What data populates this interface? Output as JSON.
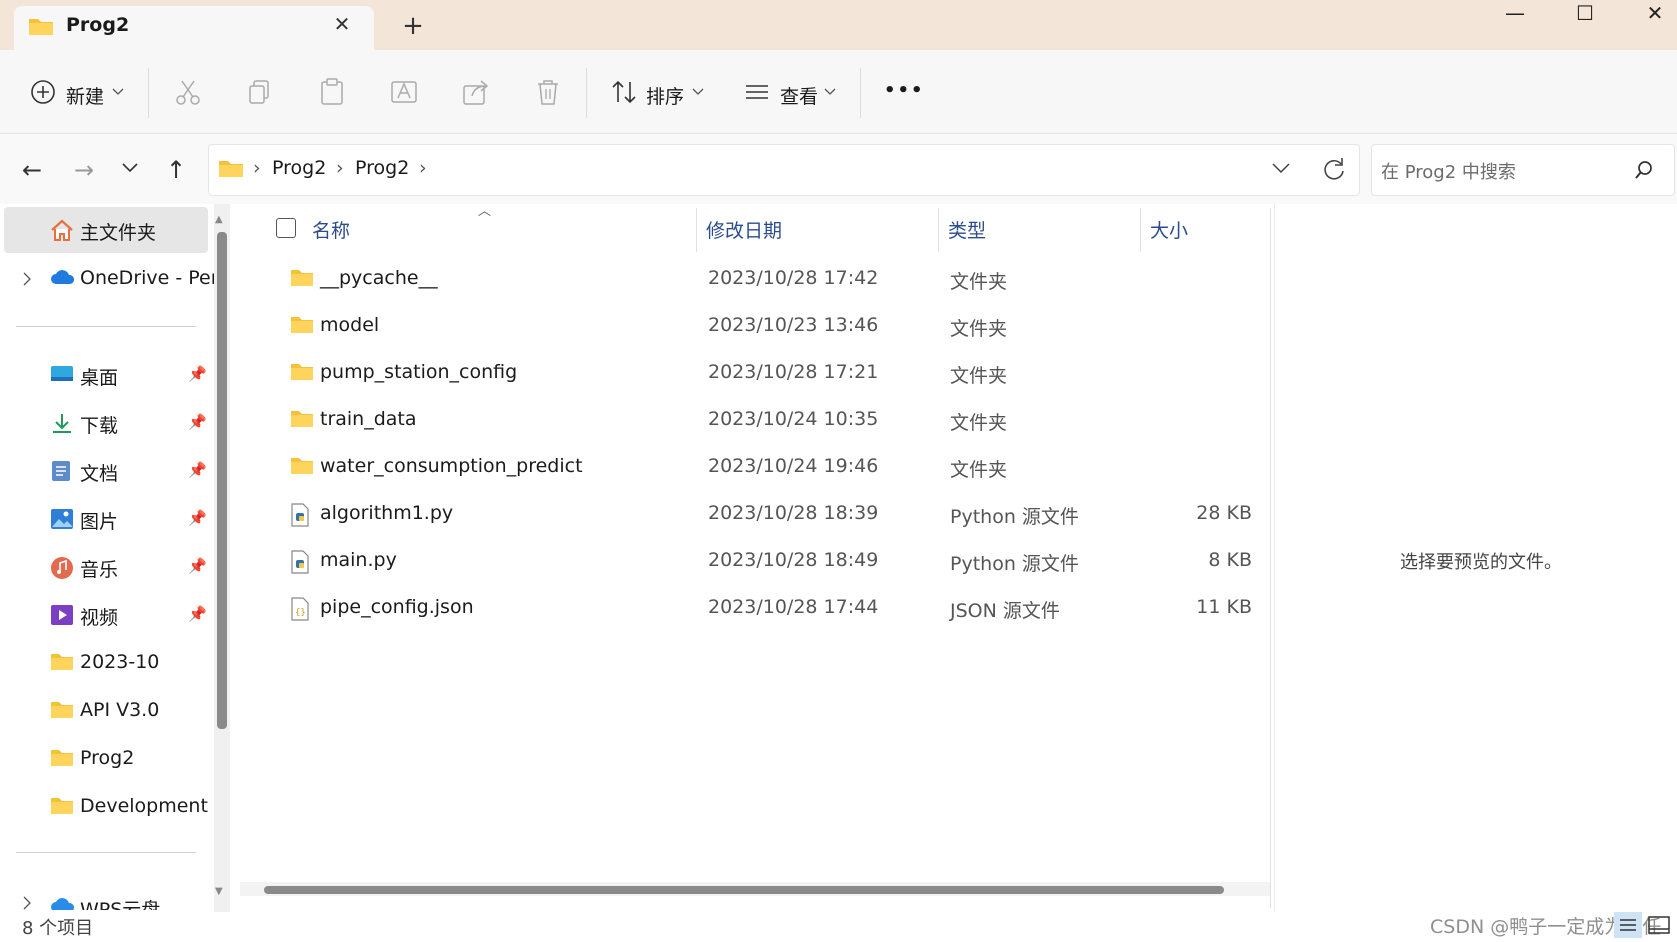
{
  "window": {
    "tab_title": "Prog2",
    "tab_close": "✕",
    "new_tab": "+",
    "minimize": "—",
    "maximize": "☐",
    "close": "✕"
  },
  "toolbar": {
    "new_label": "新建",
    "sort_label": "排序",
    "view_label": "查看",
    "more_label": "•••"
  },
  "address": {
    "crumbs": [
      "Prog2",
      "Prog2"
    ],
    "search_placeholder": "在 Prog2 中搜索"
  },
  "sidebar": {
    "home": "主文件夹",
    "onedrive": "OneDrive - Per",
    "quick": [
      {
        "label": "桌面",
        "icon": "desktop-icon"
      },
      {
        "label": "下载",
        "icon": "download-icon"
      },
      {
        "label": "文档",
        "icon": "documents-icon"
      },
      {
        "label": "图片",
        "icon": "pictures-icon"
      },
      {
        "label": "音乐",
        "icon": "music-icon"
      },
      {
        "label": "视频",
        "icon": "videos-icon"
      }
    ],
    "folders": [
      "2023-10",
      "API V3.0",
      "Prog2",
      "Development T"
    ],
    "wps": "WPS云盘"
  },
  "columns": {
    "name": "名称",
    "date": "修改日期",
    "type": "类型",
    "size": "大小"
  },
  "files": [
    {
      "name": "__pycache__",
      "date": "2023/10/28 17:42",
      "type": "文件夹",
      "size": "",
      "kind": "folder"
    },
    {
      "name": "model",
      "date": "2023/10/23 13:46",
      "type": "文件夹",
      "size": "",
      "kind": "folder"
    },
    {
      "name": "pump_station_config",
      "date": "2023/10/28 17:21",
      "type": "文件夹",
      "size": "",
      "kind": "folder"
    },
    {
      "name": "train_data",
      "date": "2023/10/24 10:35",
      "type": "文件夹",
      "size": "",
      "kind": "folder"
    },
    {
      "name": "water_consumption_predict",
      "date": "2023/10/24 19:46",
      "type": "文件夹",
      "size": "",
      "kind": "folder"
    },
    {
      "name": "algorithm1.py",
      "date": "2023/10/28 18:39",
      "type": "Python 源文件",
      "size": "28 KB",
      "kind": "python"
    },
    {
      "name": "main.py",
      "date": "2023/10/28 18:49",
      "type": "Python 源文件",
      "size": "8 KB",
      "kind": "python"
    },
    {
      "name": "pipe_config.json",
      "date": "2023/10/28 17:44",
      "type": "JSON 源文件",
      "size": "11 KB",
      "kind": "json"
    }
  ],
  "preview": {
    "message": "选择要预览的文件。"
  },
  "status": {
    "count": "8 个项目",
    "watermark": "CSDN @鸭子一定成为主任"
  },
  "colors": {
    "folder": "#f3c13a",
    "accent": "#2b4c8c",
    "titlebar": "#f3e5d8"
  }
}
